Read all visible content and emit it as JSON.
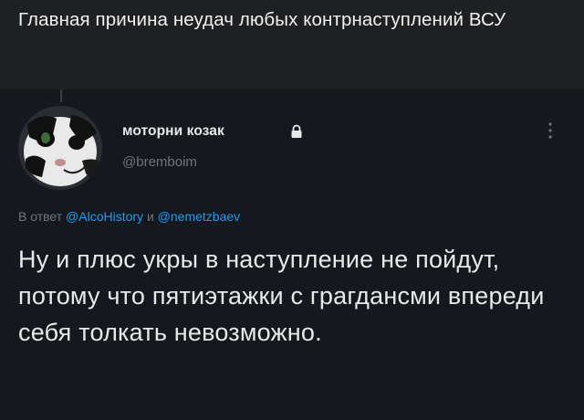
{
  "caption": {
    "text": "Главная причина неудач любых контрнаступлений ВСУ"
  },
  "tweet": {
    "author": {
      "display_name": "моторни козак",
      "handle": "@bremboim",
      "avatar": "cat-avatar",
      "lock": "lock-icon"
    },
    "more_icon": "more-vertical-icon",
    "reply": {
      "prefix": "В ответ",
      "mention_1": "@AlcoHistory",
      "conjunction": "и",
      "mention_2": "@nemetzbaev"
    },
    "text": "Ну и плюс укры в наступление не пойдут, потому что пятиэтажки с грагдансми впереди себя толкать невозможно."
  },
  "colors": {
    "caption_bg": "#1f2022",
    "tweet_bg": "#15181c",
    "text": "#e7e9ea",
    "muted": "#71767b",
    "link": "#1d9bf0"
  }
}
